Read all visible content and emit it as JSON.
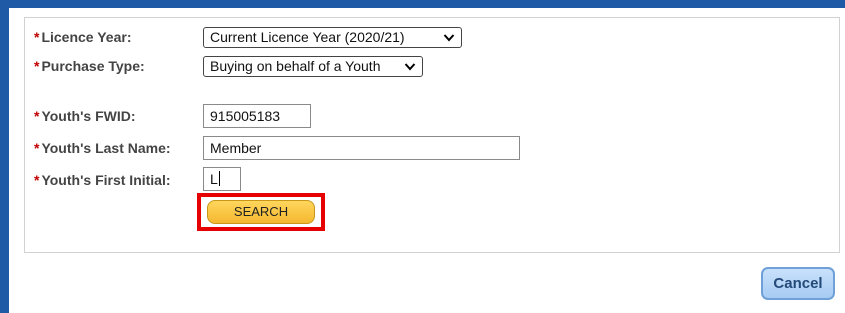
{
  "form": {
    "required_marker": "*",
    "licence_year": {
      "label": "Licence Year:",
      "selected": "Current Licence Year (2020/21)"
    },
    "purchase_type": {
      "label": "Purchase Type:",
      "selected": "Buying on behalf of a Youth"
    },
    "youth_fwid": {
      "label": "Youth's FWID:",
      "value": "915005183"
    },
    "youth_last_name": {
      "label": "Youth's Last Name:",
      "value": "Member"
    },
    "youth_first_initial": {
      "label": "Youth's First Initial:",
      "value": "L"
    },
    "search_label": "SEARCH"
  },
  "actions": {
    "cancel_label": "Cancel"
  },
  "colors": {
    "brand_border": "#1f5aa6",
    "required": "#c00000",
    "search_button": "#f5b830",
    "highlight": "#e60000",
    "cancel_button": "#a6cbf3"
  },
  "icons": {
    "dropdown": "chevron-down-icon"
  }
}
